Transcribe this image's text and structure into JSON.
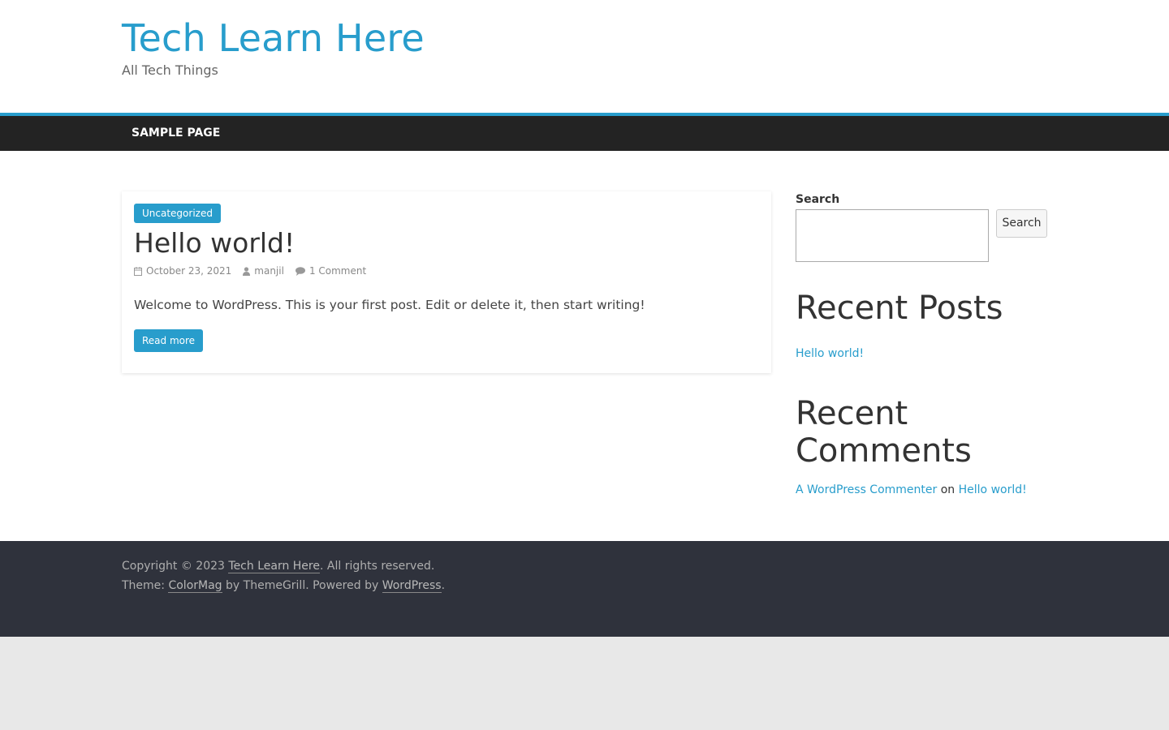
{
  "header": {
    "site_title": "Tech Learn Here",
    "tagline": "All Tech Things"
  },
  "nav": {
    "items": [
      {
        "label": "SAMPLE PAGE"
      }
    ]
  },
  "post": {
    "category": "Uncategorized",
    "title": "Hello world!",
    "date": "October 23, 2021",
    "author": "manjil",
    "comments": "1 Comment",
    "excerpt": "Welcome to WordPress. This is your first post. Edit or delete it, then start writing!",
    "read_more": "Read more"
  },
  "sidebar": {
    "search": {
      "label": "Search",
      "value": "",
      "button_label": "Search"
    },
    "recent_posts": {
      "heading": "Recent Posts",
      "items": [
        "Hello world!"
      ]
    },
    "recent_comments": {
      "heading": "Recent Comments",
      "author": "A WordPress Commenter",
      "on": "on",
      "post": "Hello world!"
    }
  },
  "footer": {
    "copyright_prefix": "Copyright © 2023 ",
    "site_link": "Tech Learn Here",
    "rights": ". All rights reserved.",
    "theme_prefix": "Theme: ",
    "theme_link": "ColorMag",
    "by_text": " by ThemeGrill. Powered by ",
    "wp_link": "WordPress",
    "end": "."
  },
  "colors": {
    "accent": "#289dcc",
    "nav_bg": "#232323",
    "footer_bg": "#2f323c"
  },
  "icons": {
    "date": "clock-icon",
    "author": "user-icon",
    "comments": "comment-icon"
  }
}
